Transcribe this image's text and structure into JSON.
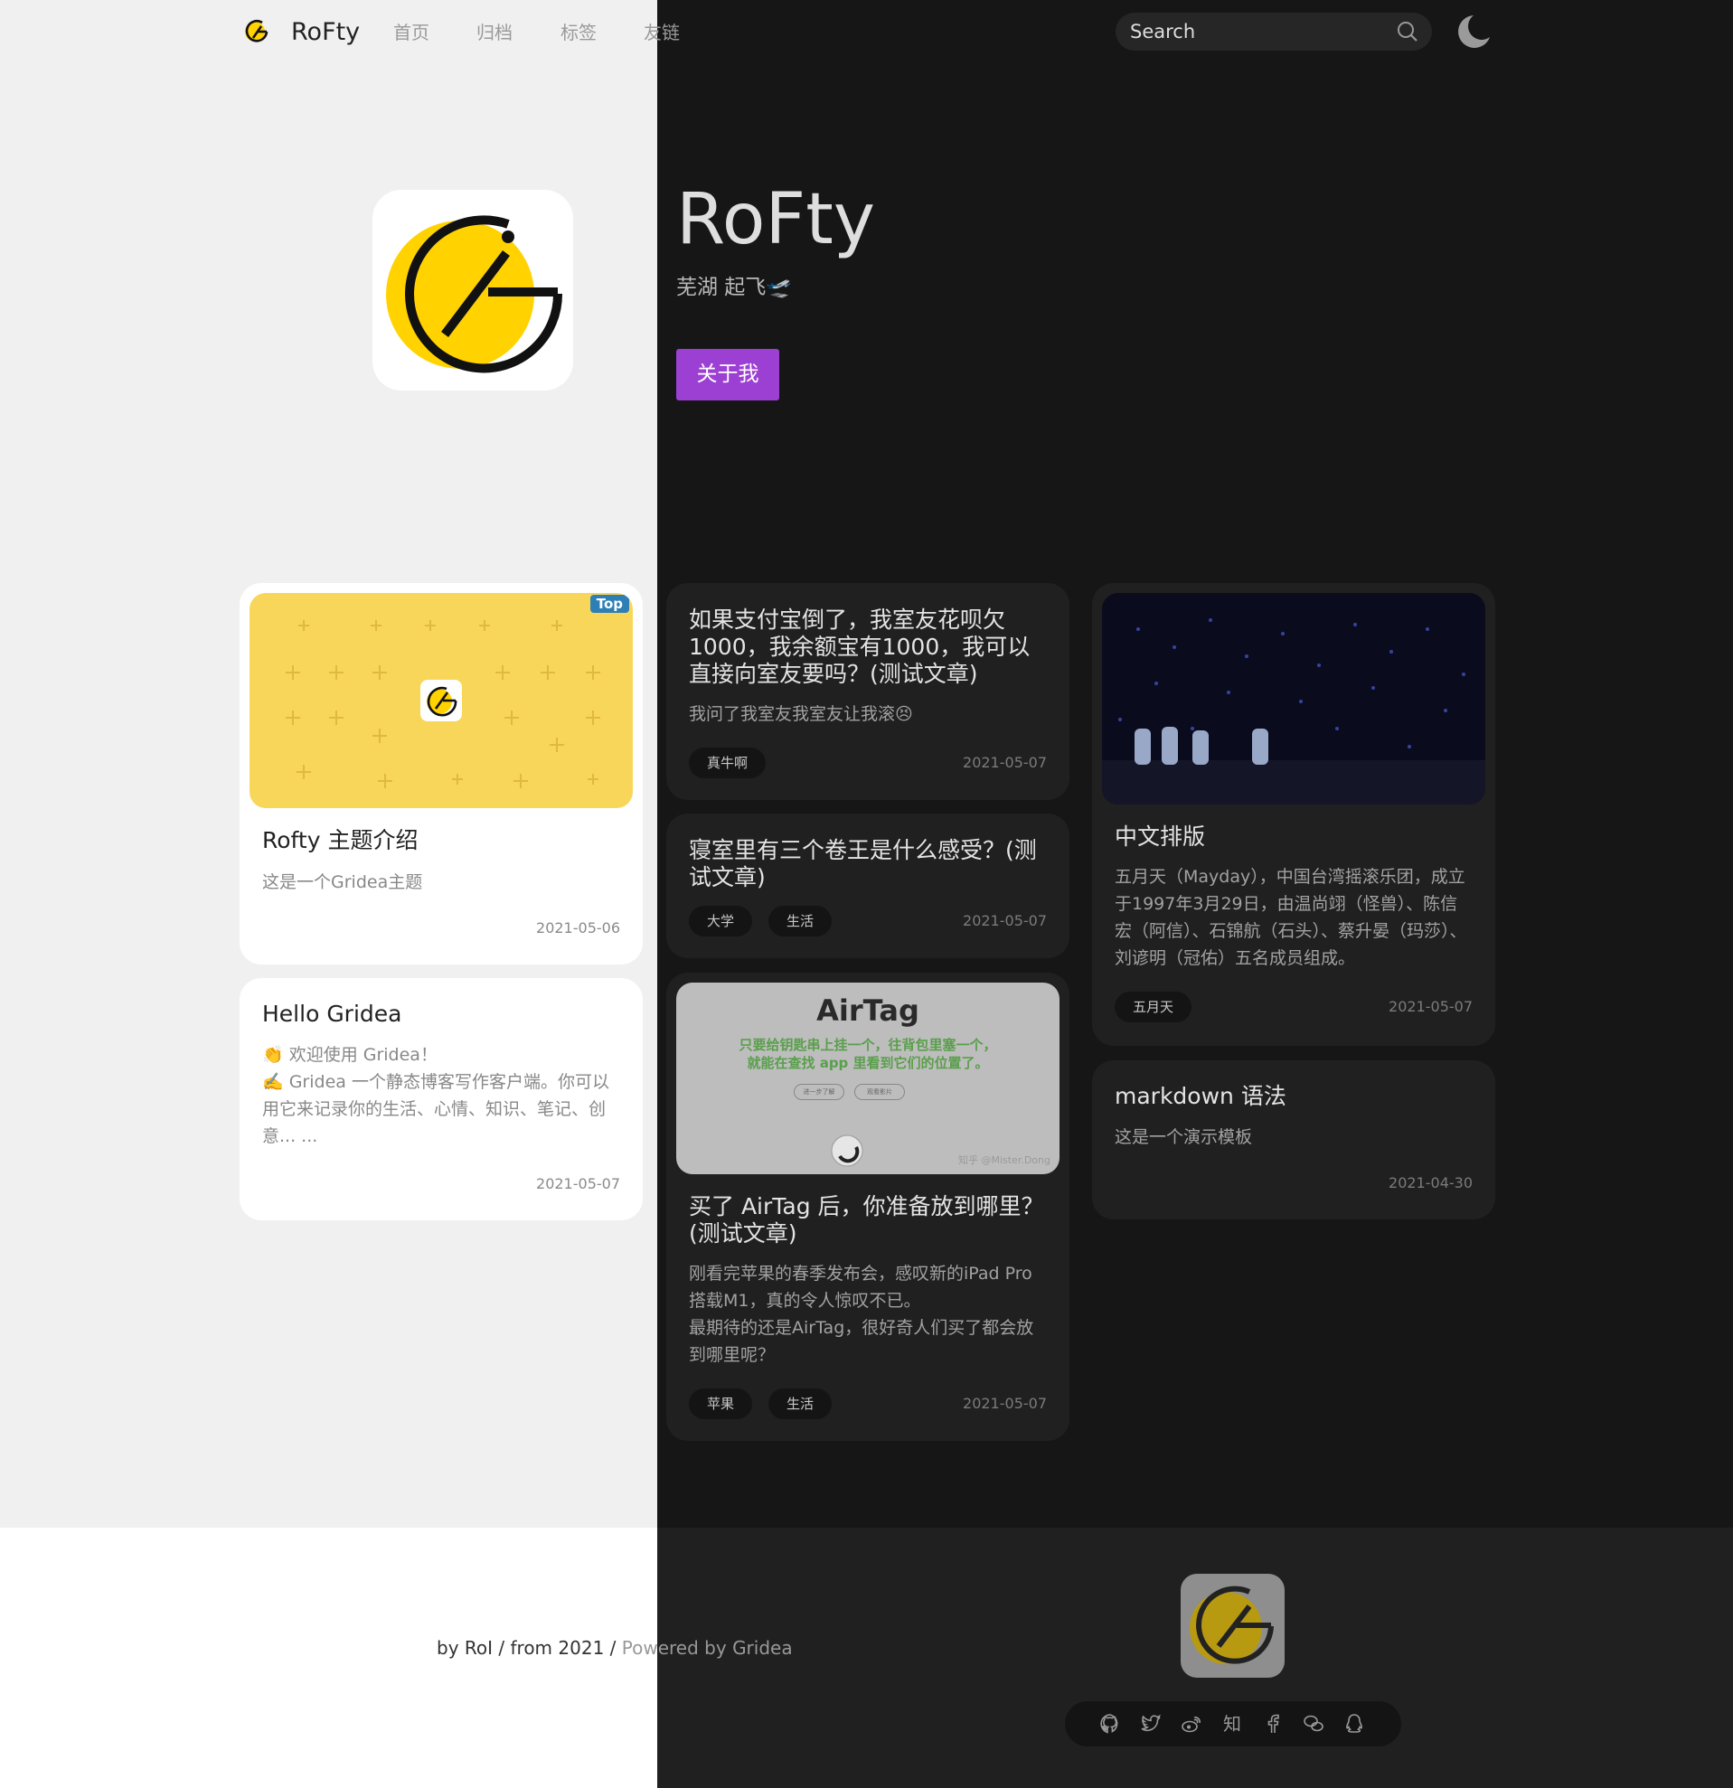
{
  "nav": {
    "brand": "RoFty",
    "items": [
      "首页",
      "归档",
      "标签",
      "友链"
    ],
    "search_placeholder": "Search"
  },
  "hero": {
    "title": "RoFty",
    "subtitle": "芜湖 起飞🛫",
    "button": "关于我"
  },
  "colors": {
    "accent": "#9c3fd3",
    "logo_yellow": "#ffd200",
    "light_bg": "#f0f0f0",
    "dark_bg": "#161616",
    "card_dark": "#202020"
  },
  "posts": [
    {
      "title": "Rofty 主题介绍",
      "desc": "这是一个Gridea主题",
      "date": "2021-05-06",
      "badge": "Top",
      "tags": []
    },
    {
      "title": "Hello Gridea",
      "desc_lines": [
        "👏 欢迎使用 Gridea！",
        "✍️ Gridea 一个静态博客写作客户端。你可以用它来记录你的生活、心情、知识、笔记、创意... ..."
      ],
      "date": "2021-05-07",
      "tags": []
    },
    {
      "title": "如果支付宝倒了，我室友花呗欠1000，我余额宝有1000，我可以直接向室友要吗？(测试文章)",
      "desc": "我问了我室友我室友让我滚😣",
      "date": "2021-05-07",
      "tags": [
        "真牛啊"
      ]
    },
    {
      "title": "寝室里有三个卷王是什么感受？(测试文章)",
      "date": "2021-05-07",
      "tags": [
        "大学",
        "生活"
      ]
    },
    {
      "title": "买了 AirTag 后，你准备放到哪里？(测试文章)",
      "desc_lines": [
        "刚看完苹果的春季发布会，感叹新的iPad Pro搭载M1，真的令人惊叹不已。",
        "最期待的还是AirTag，很好奇人们买了都会放到哪里呢？"
      ],
      "date": "2021-05-07",
      "tags": [
        "苹果",
        "生活"
      ],
      "image": {
        "title": "AirTag",
        "line1": "只要给钥匙串上挂一个，往背包里塞一个，",
        "line2": "就能在查找 app 里看到它们的位置了。",
        "btn1": "进一步了解",
        "btn2": "观看影片",
        "watermark": "知乎 @Mister.Dong"
      }
    },
    {
      "title": "中文排版",
      "desc": "五月天（Mayday），中国台湾摇滚乐团，成立于1997年3月29日，由温尚翊（怪兽）、陈信宏（阿信）、石锦航（石头）、蔡升晏（玛莎）、刘谚明（冠佑）五名成员组成。",
      "date": "2021-05-07",
      "tags": [
        "五月天"
      ]
    },
    {
      "title": "markdown 语法",
      "desc": "这是一个演示模板",
      "date": "2021-04-30",
      "tags": []
    }
  ],
  "footer": {
    "by": "by",
    "author": "RoI",
    "sep1": "/",
    "from": "from 2021",
    "sep2": "/",
    "powered": "Powered by",
    "powered_name": "Gridea",
    "zhi": "知",
    "social_icons": [
      "github-icon",
      "twitter-icon",
      "weibo-icon",
      "zhihu-icon",
      "facebook-icon",
      "wechat-icon",
      "qq-icon"
    ]
  }
}
